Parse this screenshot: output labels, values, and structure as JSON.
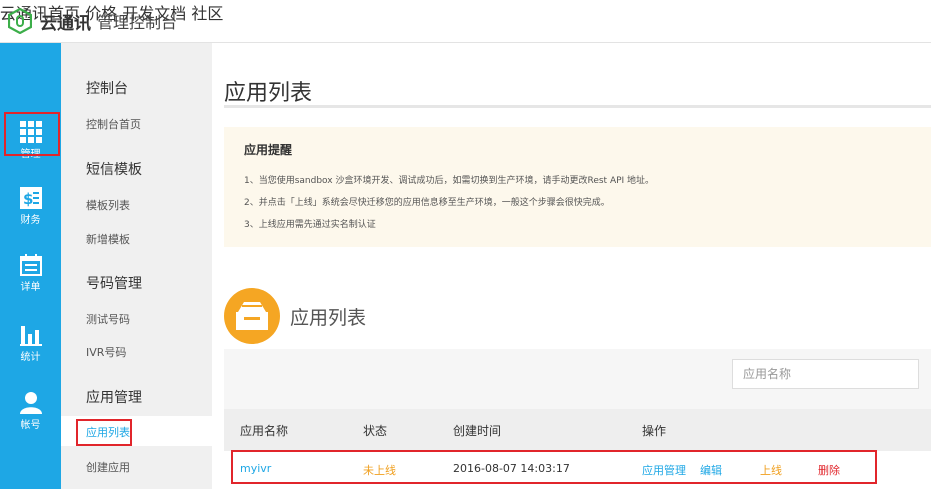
{
  "header": {
    "brand": "云通讯",
    "subtitle": "管理控制台",
    "nav": [
      "云通讯首页",
      "价格",
      "开发文档",
      "社区"
    ]
  },
  "iconbar": {
    "items": [
      {
        "label": "管理",
        "icon": "grid-icon"
      },
      {
        "label": "财务",
        "icon": "finance-icon"
      },
      {
        "label": "详单",
        "icon": "calendar-icon"
      },
      {
        "label": "统计",
        "icon": "bar-chart-icon"
      },
      {
        "label": "帐号",
        "icon": "user-icon"
      }
    ]
  },
  "subbar": {
    "sections": [
      {
        "heading": "控制台",
        "links": [
          "控制台首页"
        ]
      },
      {
        "heading": "短信模板",
        "links": [
          "模板列表",
          "新增模板"
        ]
      },
      {
        "heading": "号码管理",
        "links": [
          "测试号码",
          "IVR号码"
        ]
      },
      {
        "heading": "应用管理",
        "links": [
          "应用列表",
          "创建应用"
        ]
      }
    ],
    "active": "应用列表"
  },
  "main": {
    "page_title": "应用列表",
    "notice": {
      "title": "应用提醒",
      "lines": [
        "1、当您使用sandbox 沙盒环境开发、调试成功后，如需切换到生产环境，请手动更改Rest API 地址。",
        "2、并点击「上线」系统会尽快迁移您的应用信息移至生产环境，一般这个步骤会很快完成。",
        "3、上线应用需先通过实名制认证"
      ]
    },
    "section_title": "应用列表",
    "search_placeholder": "应用名称",
    "table": {
      "columns": [
        "应用名称",
        "状态",
        "创建时间",
        "操作"
      ],
      "rows": [
        {
          "name": "myivr",
          "status": "未上线",
          "created": "2016-08-07 14:03:17",
          "actions": [
            "应用管理",
            "编辑",
            "上线",
            "删除"
          ]
        }
      ]
    }
  },
  "colors": {
    "sidebar_blue": "#1ea7e5",
    "link_blue": "#1ea7e5",
    "status_orange": "#f0a020",
    "delete_red": "#e1252b",
    "highlight_red": "#e1252b",
    "accent_orange": "#f5a623"
  }
}
